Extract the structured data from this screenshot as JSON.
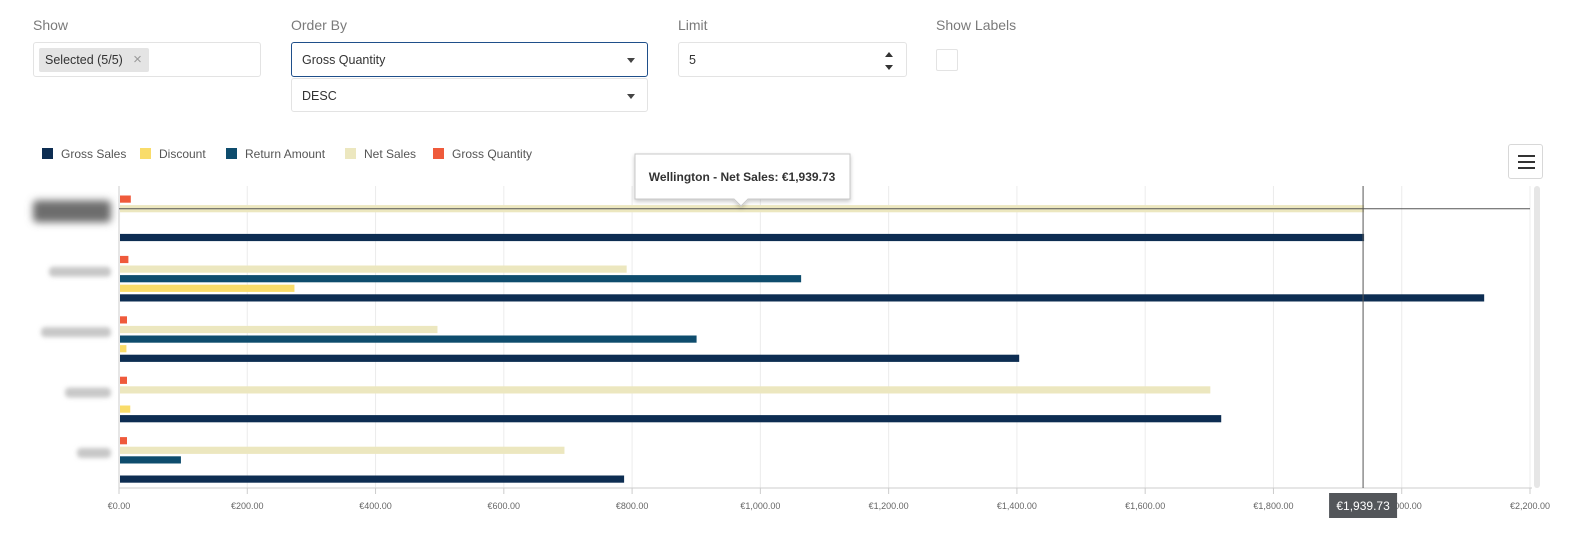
{
  "controls": {
    "show": {
      "label": "Show",
      "chip": "Selected (5/5)",
      "chip_remove": "×"
    },
    "order_by": {
      "label": "Order By",
      "field": "Gross Quantity",
      "direction": "DESC"
    },
    "limit": {
      "label": "Limit",
      "value": "5"
    },
    "show_labels": {
      "label": "Show Labels",
      "checked": false
    }
  },
  "tooltip": {
    "text": "Wellington - Net Sales: €1,939.73"
  },
  "crosshair": {
    "value": 1939.73,
    "label": "€1,939.73",
    "category_index": 0
  },
  "colors": {
    "gross_sales": "#0d2d52",
    "discount": "#f9dc6a",
    "return_amount": "#0e4c6d",
    "net_sales": "#ece7bf",
    "gross_quantity": "#ef5a3b"
  },
  "chart_data": {
    "type": "bar",
    "orientation": "horizontal",
    "categories": [
      "",
      "",
      "",
      "",
      ""
    ],
    "series": [
      {
        "name": "Gross Sales",
        "color": "#0d2d52",
        "values": [
          1939.73,
          2127,
          1402,
          1717,
          786
        ]
      },
      {
        "name": "Discount",
        "color": "#f9dc6a",
        "values": [
          0,
          272,
          10,
          16,
          0
        ]
      },
      {
        "name": "Return Amount",
        "color": "#0e4c6d",
        "values": [
          0,
          1062,
          899,
          0,
          95
        ]
      },
      {
        "name": "Net Sales",
        "color": "#ece7bf",
        "values": [
          1939.73,
          790,
          495,
          1700,
          693
        ]
      },
      {
        "name": "Gross Quantity",
        "color": "#ef5a3b",
        "values": [
          18,
          14,
          11,
          11,
          10
        ]
      }
    ],
    "xlim": [
      0,
      2200
    ],
    "xticks": [
      "€0.00",
      "€200.00",
      "€400.00",
      "€600.00",
      "€800.00",
      "€1,000.00",
      "€1,200.00",
      "€1,400.00",
      "€1,600.00",
      "€1,800.00",
      "€2,000.00",
      "€2,200.00"
    ],
    "legend_position": "top-left",
    "grid": true
  }
}
